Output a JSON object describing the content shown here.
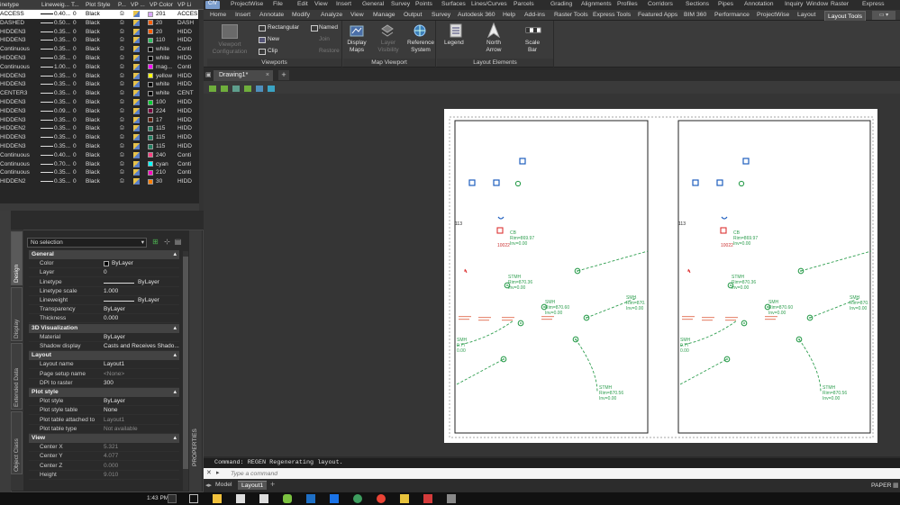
{
  "layer_table": {
    "columns": [
      "inetype",
      "Lineweig...",
      "T...",
      "Plot Style",
      "P...",
      "VP ...",
      "VP Color",
      "VP Li"
    ],
    "rows": [
      {
        "ltype": "ACCESS",
        "lw": "0.40...",
        "t": "0",
        "style": "Black",
        "color": "201",
        "vpl": "ACCES",
        "sw": "#d9a7ff",
        "sel": true
      },
      {
        "ltype": "DASHED",
        "lw": "0.50...",
        "t": "0",
        "style": "Black",
        "color": "20",
        "vpl": "DASH",
        "sw": "#ff5f00"
      },
      {
        "ltype": "HIDDEN3",
        "lw": "0.35...",
        "t": "0",
        "style": "Black",
        "color": "20",
        "vpl": "HIDD",
        "sw": "#ff5f00"
      },
      {
        "ltype": "HIDDEN3",
        "lw": "0.35...",
        "t": "0",
        "style": "Black",
        "color": "110",
        "vpl": "HIDD",
        "sw": "#2fbf5f"
      },
      {
        "ltype": "Continuous",
        "lw": "0.35...",
        "t": "0",
        "style": "Black",
        "color": "white",
        "vpl": "Conti",
        "sw": "#000000"
      },
      {
        "ltype": "HIDDEN3",
        "lw": "0.35...",
        "t": "0",
        "style": "Black",
        "color": "white",
        "vpl": "HIDD",
        "sw": "#000000"
      },
      {
        "ltype": "Continuous",
        "lw": "1.00...",
        "t": "0",
        "style": "Black",
        "color": "mag...",
        "vpl": "Conti",
        "sw": "#ff00ff"
      },
      {
        "ltype": "HIDDEN3",
        "lw": "0.35...",
        "t": "0",
        "style": "Black",
        "color": "yellow",
        "vpl": "HIDD",
        "sw": "#ffff00"
      },
      {
        "ltype": "HIDDEN3",
        "lw": "0.35...",
        "t": "0",
        "style": "Black",
        "color": "white",
        "vpl": "HIDD",
        "sw": "#000000"
      },
      {
        "ltype": "CENTER3",
        "lw": "0.35...",
        "t": "0",
        "style": "Black",
        "color": "white",
        "vpl": "CENT",
        "sw": "#000000"
      },
      {
        "ltype": "HIDDEN3",
        "lw": "0.35...",
        "t": "0",
        "style": "Black",
        "color": "100",
        "vpl": "HIDD",
        "sw": "#00cc33"
      },
      {
        "ltype": "HIDDEN3",
        "lw": "0.09...",
        "t": "0",
        "style": "Black",
        "color": "224",
        "vpl": "HIDD",
        "sw": "#7a0040"
      },
      {
        "ltype": "HIDDEN3",
        "lw": "0.35...",
        "t": "0",
        "style": "Black",
        "color": "17",
        "vpl": "HIDD",
        "sw": "#5a1f0f"
      },
      {
        "ltype": "HIDDEN2",
        "lw": "0.35...",
        "t": "0",
        "style": "Black",
        "color": "115",
        "vpl": "HIDD",
        "sw": "#1f7f5f"
      },
      {
        "ltype": "HIDDEN3",
        "lw": "0.35...",
        "t": "0",
        "style": "Black",
        "color": "115",
        "vpl": "HIDD",
        "sw": "#1f7f5f"
      },
      {
        "ltype": "HIDDEN3",
        "lw": "0.35...",
        "t": "0",
        "style": "Black",
        "color": "115",
        "vpl": "HIDD",
        "sw": "#1f7f5f"
      },
      {
        "ltype": "Continuous",
        "lw": "0.40...",
        "t": "0",
        "style": "Black",
        "color": "240",
        "vpl": "Conti",
        "sw": "#ff3f7f"
      },
      {
        "ltype": "Continuous",
        "lw": "0.70...",
        "t": "0",
        "style": "Black",
        "color": "cyan",
        "vpl": "Conti",
        "sw": "#00ffff"
      },
      {
        "ltype": "Continuous",
        "lw": "0.35...",
        "t": "0",
        "style": "Black",
        "color": "210",
        "vpl": "Conti",
        "sw": "#ff00bf"
      },
      {
        "ltype": "HIDDEN2",
        "lw": "0.35...",
        "t": "0",
        "style": "Black",
        "color": "30",
        "vpl": "HIDD",
        "sw": "#ff7f00"
      }
    ]
  },
  "properties": {
    "selection": "No selection",
    "vtabs": [
      "Design",
      "Display",
      "Extended Data",
      "Object Class"
    ],
    "panel_label": "PROPERTIES",
    "sections": [
      {
        "title": "General",
        "rows": [
          {
            "k": "Color",
            "v": "ByLayer",
            "swatch": true
          },
          {
            "k": "Layer",
            "v": "0"
          },
          {
            "k": "Linetype",
            "v": "ByLayer",
            "line": true
          },
          {
            "k": "Linetype scale",
            "v": "1.000"
          },
          {
            "k": "Lineweight",
            "v": "ByLayer",
            "line": true
          },
          {
            "k": "Transparency",
            "v": "ByLayer"
          },
          {
            "k": "Thickness",
            "v": "0.000"
          }
        ]
      },
      {
        "title": "3D Visualization",
        "rows": [
          {
            "k": "Material",
            "v": "ByLayer"
          },
          {
            "k": "Shadow display",
            "v": "Casts and Receives Shado..."
          }
        ]
      },
      {
        "title": "Layout",
        "rows": [
          {
            "k": "Layout name",
            "v": "Layout1"
          },
          {
            "k": "Page setup name",
            "v": "<None>",
            "dis": true
          },
          {
            "k": "DPI to raster",
            "v": "300"
          }
        ]
      },
      {
        "title": "Plot style",
        "rows": [
          {
            "k": "Plot style",
            "v": "ByLayer"
          },
          {
            "k": "Plot style table",
            "v": "None"
          },
          {
            "k": "Plot table attached to",
            "v": "Layout1",
            "dis": true
          },
          {
            "k": "Plot table type",
            "v": "Not available",
            "dis": true
          }
        ]
      },
      {
        "title": "View",
        "rows": [
          {
            "k": "Center X",
            "v": "5.321",
            "dis": true
          },
          {
            "k": "Center Y",
            "v": "4.077",
            "dis": true
          },
          {
            "k": "Center Z",
            "v": "0.000",
            "dis": true
          },
          {
            "k": "Height",
            "v": "9.010",
            "dis": true
          }
        ]
      }
    ]
  },
  "menu": [
    "ProjectWise",
    "File",
    "Edit",
    "View",
    "Insert",
    "General",
    "Survey",
    "Points",
    "Surfaces",
    "Lines/Curves",
    "Parcels",
    "Grading",
    "Alignments",
    "Profiles",
    "Corridors",
    "Sections",
    "Pipes",
    "Annotation",
    "Inquiry",
    "Window",
    "Raster",
    "Express"
  ],
  "ribbon_tabs": [
    "Home",
    "Insert",
    "Annotate",
    "Modify",
    "Analyze",
    "View",
    "Manage",
    "Output",
    "Survey",
    "Autodesk 360",
    "Help",
    "Add-ins",
    "Raster Tools",
    "Express Tools",
    "Featured Apps",
    "BIM 360",
    "Performance",
    "ProjectWise",
    "Layout",
    "Layout Tools"
  ],
  "active_ribbon_tab": "Layout Tools",
  "ribbon": {
    "viewports": {
      "title": "Viewports",
      "viewport_config": "Viewport Configuration",
      "rectangular": "Rectangular",
      "new": "New",
      "clip": "Clip",
      "named": "Named",
      "join": "Join",
      "restore": "Restore"
    },
    "map_viewport": {
      "title": "Map Viewport",
      "display_maps": "Display Maps",
      "layer_visibility": "Layer Visibility",
      "reference_system": "Reference System"
    },
    "layout_elements": {
      "title": "Layout Elements",
      "legend": "Legend",
      "north_arrow": "North Arrow",
      "scale_bar": "Scale Bar"
    }
  },
  "drawing_tab": "Drawing1*",
  "command": {
    "history": "Command: REGEN Regenerating layout.",
    "placeholder": "Type a command"
  },
  "layout_tabs": [
    "Model",
    "Layout1"
  ],
  "active_layout_tab": "Layout1",
  "status_mode": "PAPER",
  "clock": "1:43 PM",
  "drawing": {
    "cb_label": "CB",
    "cb_rim": "Rim=869.97",
    "cb_inv": "Inv=0.00",
    "stmh1": [
      "STMH",
      "Rim=870.36",
      "Inv=0.00"
    ],
    "smh1": [
      "SMH",
      "Rim=870.60",
      "Inv=0.00"
    ],
    "smh2": [
      "SMH",
      "Rim=870.",
      "Inv=0.00"
    ],
    "smh3": [
      "SMH",
      "0.77",
      "0.00"
    ],
    "stmh2": [
      "STMH",
      "Rim=870.56",
      "Inv=0.00"
    ],
    "misc": [
      "113",
      "10022"
    ]
  }
}
